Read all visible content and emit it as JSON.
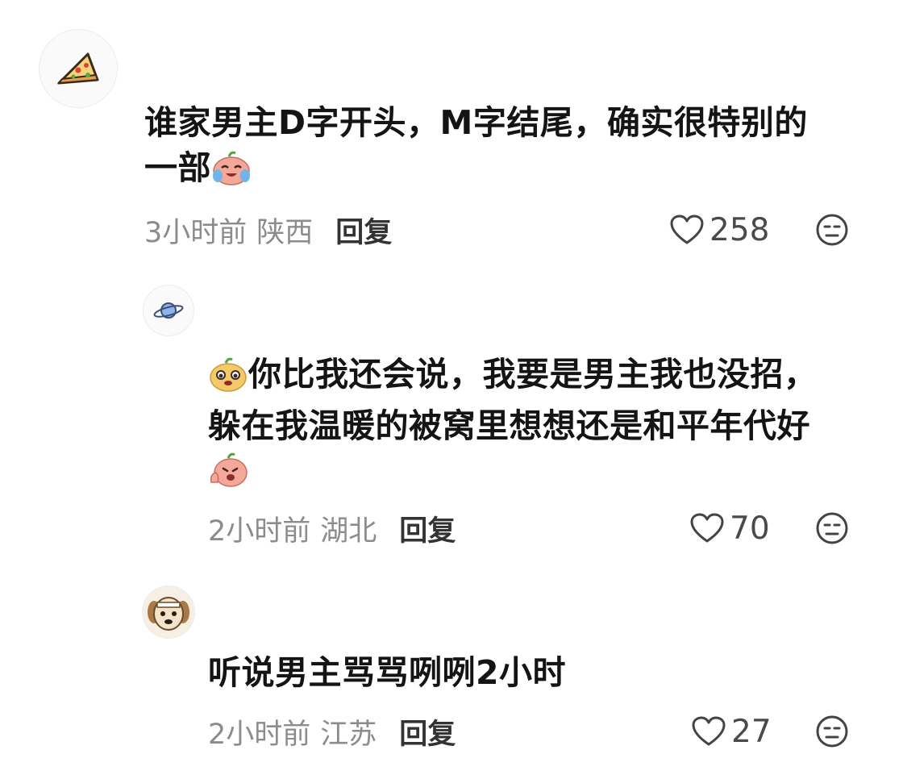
{
  "comments": [
    {
      "text_line1": "谁家男主D字开头，M字结尾，确实很特别的",
      "text_line2": "一部",
      "time": "3小时前",
      "location": "陕西",
      "reply_label": "回复",
      "likes": "258",
      "avatar_icon": "pizza-icon"
    },
    {
      "text_line1": "你比我还会说，我要是男主我也没招，",
      "text_line2": "躲在我温暖的被窝里想想还是和平年代好",
      "time": "2小时前",
      "location": "湖北",
      "reply_label": "回复",
      "likes": "70",
      "avatar_icon": "planet-icon"
    },
    {
      "text_line1": "听说男主骂骂咧咧2小时",
      "time": "2小时前",
      "location": "江苏",
      "reply_label": "回复",
      "likes": "27",
      "avatar_icon": "dog-avatar-icon"
    }
  ],
  "colors": {
    "text": "#141414",
    "meta": "#8c8c8c",
    "icon": "#444444"
  }
}
